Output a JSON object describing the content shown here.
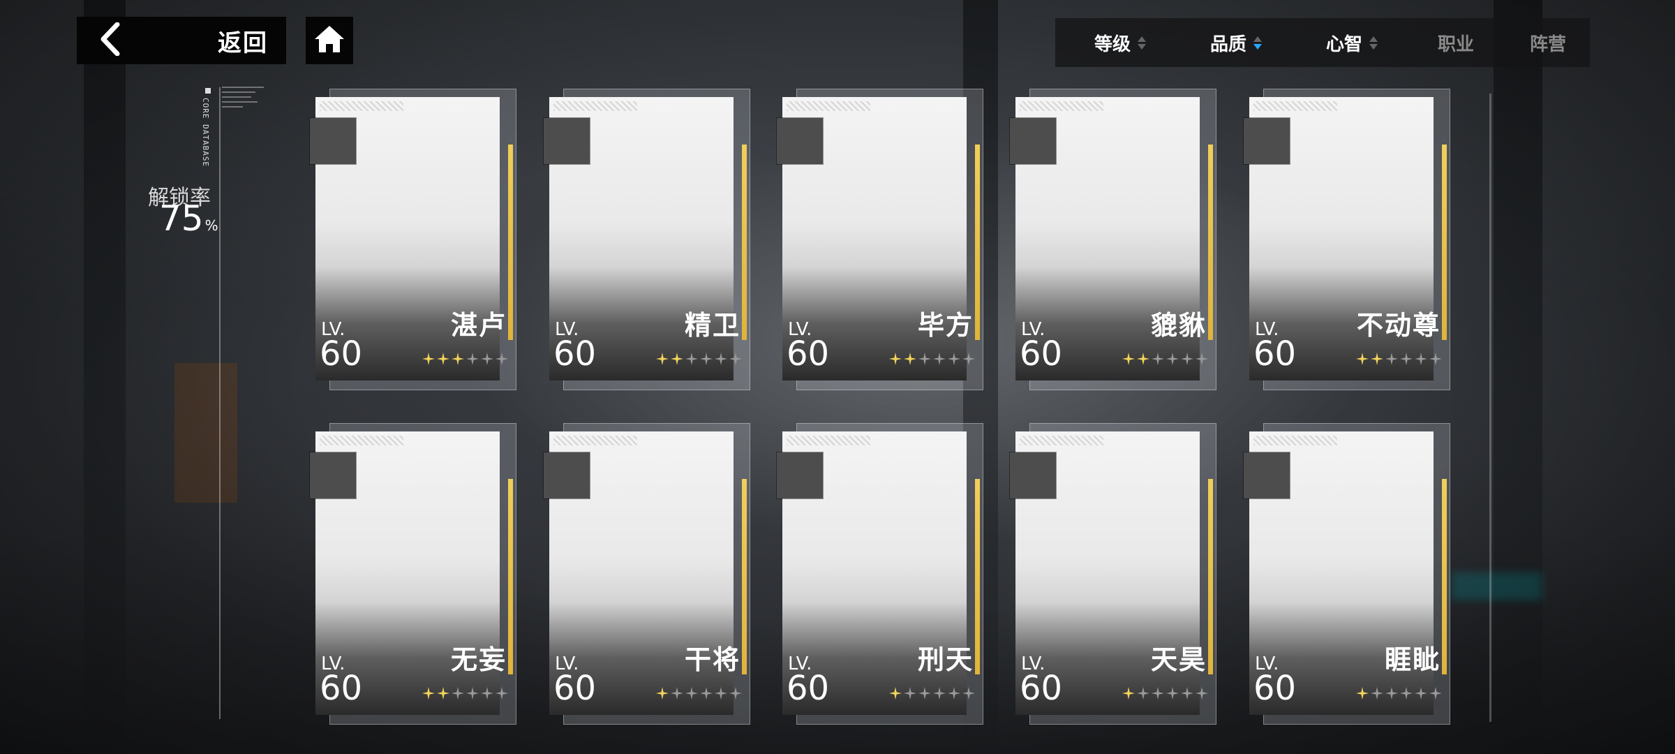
{
  "nav": {
    "back_label": "返回"
  },
  "sort": {
    "items": [
      {
        "label": "等级",
        "state": "none"
      },
      {
        "label": "品质",
        "state": "desc"
      },
      {
        "label": "心智",
        "state": "none"
      },
      {
        "label": "职业",
        "state": "disabled"
      },
      {
        "label": "阵营",
        "state": "disabled"
      }
    ]
  },
  "side": {
    "vertical_text": "CORE DATABASE",
    "unlock_label": "解锁率",
    "unlock_value": "75",
    "unlock_unit": "%"
  },
  "cards": [
    {
      "name": "湛卢",
      "lv_label": "LV.",
      "level": "60",
      "stars": 3,
      "max_stars": 6
    },
    {
      "name": "精卫",
      "lv_label": "LV.",
      "level": "60",
      "stars": 2,
      "max_stars": 6
    },
    {
      "name": "毕方",
      "lv_label": "LV.",
      "level": "60",
      "stars": 2,
      "max_stars": 6
    },
    {
      "name": "貔貅",
      "lv_label": "LV.",
      "level": "60",
      "stars": 2,
      "max_stars": 6
    },
    {
      "name": "不动尊",
      "lv_label": "LV.",
      "level": "60",
      "stars": 2,
      "max_stars": 6
    },
    {
      "name": "无妄",
      "lv_label": "LV.",
      "level": "60",
      "stars": 2,
      "max_stars": 6
    },
    {
      "name": "干将",
      "lv_label": "LV.",
      "level": "60",
      "stars": 1,
      "max_stars": 6
    },
    {
      "name": "刑天",
      "lv_label": "LV.",
      "level": "60",
      "stars": 1,
      "max_stars": 6
    },
    {
      "name": "天昊",
      "lv_label": "LV.",
      "level": "60",
      "stars": 1,
      "max_stars": 6
    },
    {
      "name": "睚眦",
      "lv_label": "LV.",
      "level": "60",
      "stars": 1,
      "max_stars": 6
    }
  ],
  "colors": {
    "accent_gold": "#f1cf5a",
    "sort_active": "#2aa7ff"
  }
}
